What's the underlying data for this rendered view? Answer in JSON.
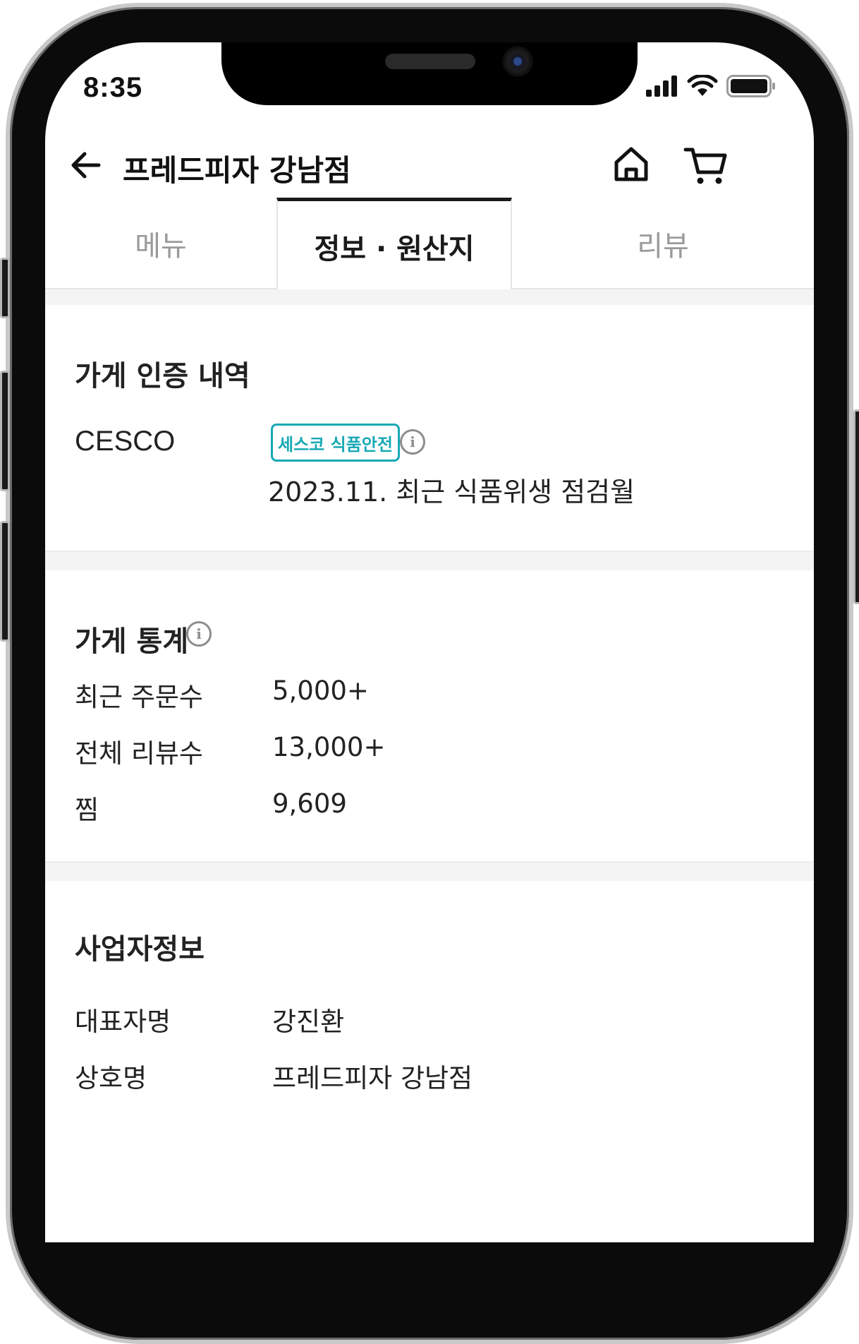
{
  "status_bar": {
    "time": "8:35"
  },
  "header": {
    "title": "프레드피자 강남점"
  },
  "tabs": [
    {
      "label": "메뉴",
      "active": false
    },
    {
      "label": "정보 · 원산지",
      "active": true
    },
    {
      "label": "리뷰",
      "active": false
    }
  ],
  "certification": {
    "title": "가게 인증 내역",
    "label": "CESCO",
    "badge": "세스코 식품안전",
    "detail": "2023.11. 최근 식품위생 점검월"
  },
  "stats": {
    "title": "가게 통계",
    "rows": [
      {
        "label": "최근 주문수",
        "value": "5,000+"
      },
      {
        "label": "전체 리뷰수",
        "value": "13,000+"
      },
      {
        "label": "찜",
        "value": "9,609"
      }
    ]
  },
  "business": {
    "title": "사업자정보",
    "rows": [
      {
        "label": "대표자명",
        "value": "강진환"
      },
      {
        "label": "상호명",
        "value": "프레드피자 강남점"
      }
    ]
  },
  "icons": {
    "back": "arrow-left-icon",
    "home": "home-icon",
    "cart": "cart-icon",
    "info": "info-icon"
  },
  "colors": {
    "badge_accent": "#17a9b5",
    "active_tab": "#1a1a1a",
    "inactive_tab": "#9a9a9a"
  }
}
